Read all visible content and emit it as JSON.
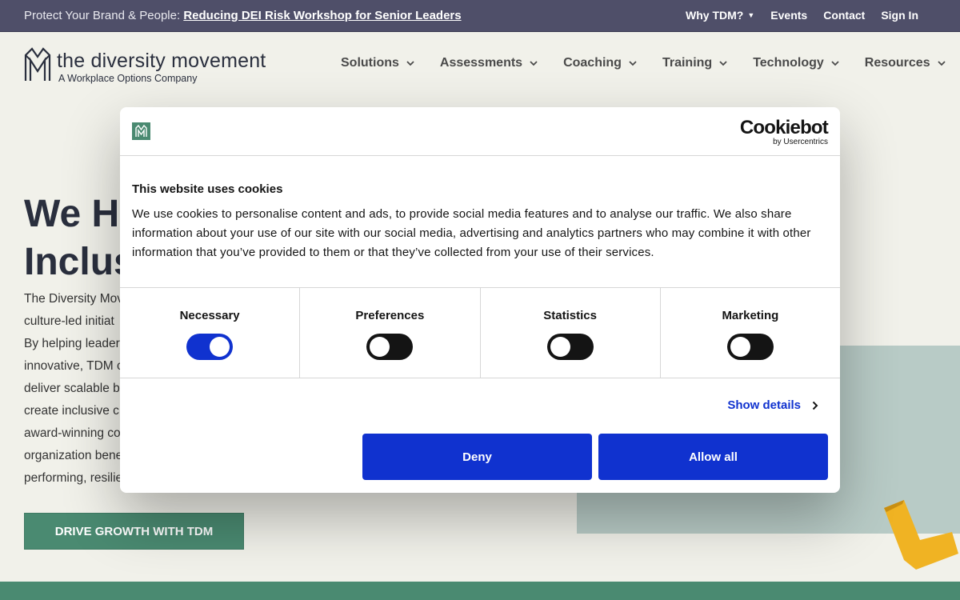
{
  "topbar": {
    "promo_prefix": "Protect Your Brand & People:",
    "promo_link": "Reducing DEI Risk Workshop for Senior Leaders",
    "links": [
      "Why TDM?",
      "Events",
      "Contact",
      "Sign In"
    ]
  },
  "header": {
    "logo_name": "the diversity movement",
    "logo_sub": "A Workplace Options Company",
    "nav": [
      "Solutions",
      "Assessments",
      "Coaching",
      "Training",
      "Technology",
      "Resources"
    ]
  },
  "hero": {
    "title_line1": "We He",
    "title_line2": "Inclus",
    "paragraph_lines": [
      "The Diversity Mov",
      "culture-led initiat",
      "By helping leader",
      "innovative, TDM c",
      "deliver scalable b",
      "create inclusive c",
      "award-winning co",
      "organization bene",
      "performing, resilie"
    ],
    "cta": "DRIVE GROWTH WITH TDM"
  },
  "cookie_dialog": {
    "brand_main": "Cookiebot",
    "brand_sub": "by Usercentrics",
    "title": "This website uses cookies",
    "description": "We use cookies to personalise content and ads, to provide social media features and to analyse our traffic. We also share information about your use of our site with our social media, advertising and analytics partners who may combine it with other information that you’ve provided to them or that they’ve collected from your use of their services.",
    "categories": [
      {
        "label": "Necessary",
        "enabled": true
      },
      {
        "label": "Preferences",
        "enabled": false
      },
      {
        "label": "Statistics",
        "enabled": false
      },
      {
        "label": "Marketing",
        "enabled": false
      }
    ],
    "show_details": "Show details",
    "deny": "Deny",
    "allow_all": "Allow all"
  },
  "colors": {
    "topbar": "#4f4f69",
    "brand_green": "#4a8a71",
    "cookie_blue": "#1032cf",
    "page_bg": "#f1f1ea"
  }
}
